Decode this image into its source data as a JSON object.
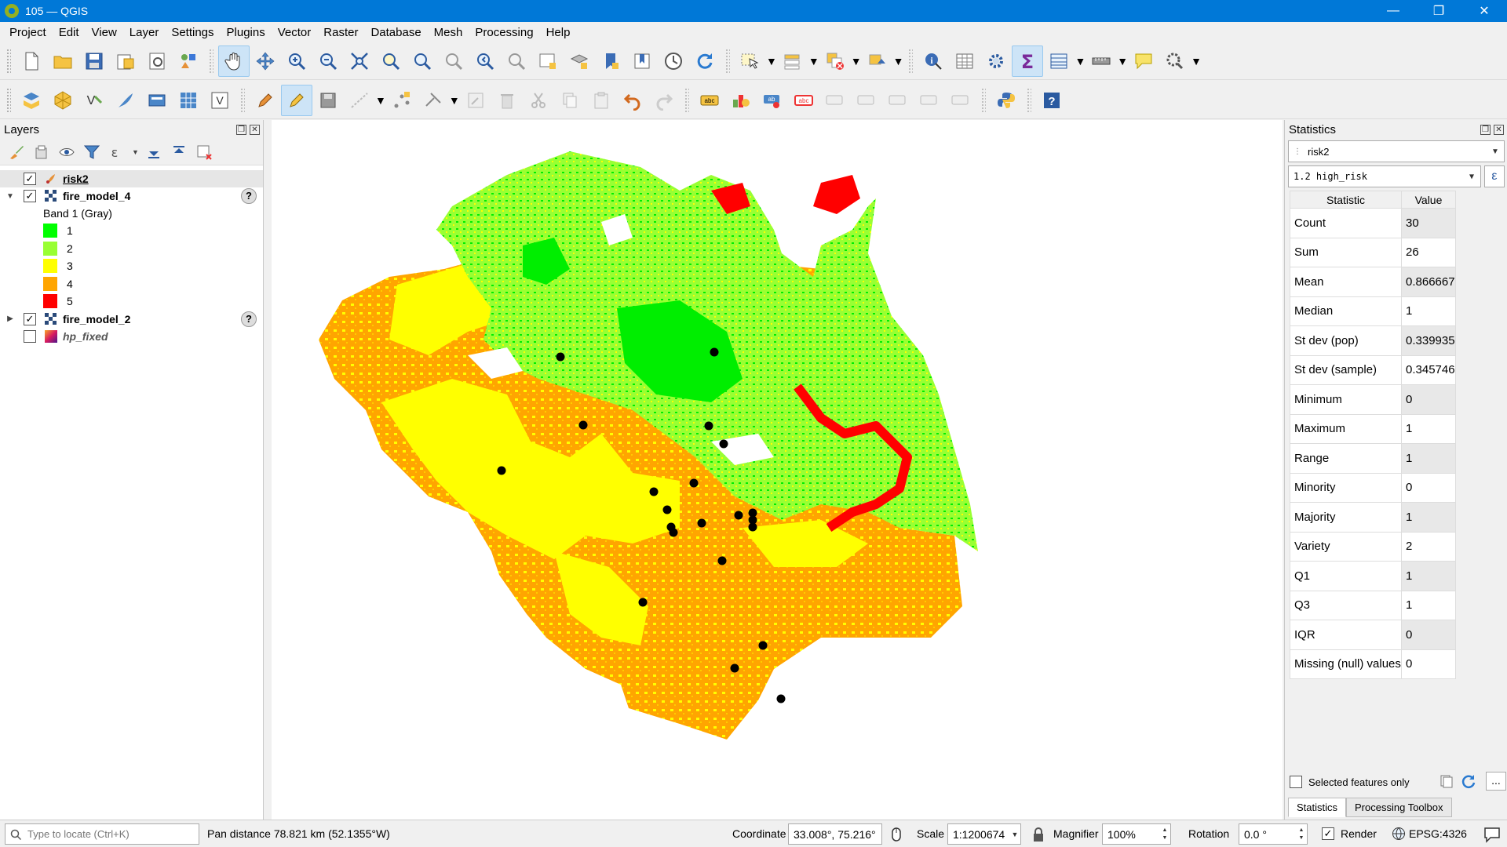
{
  "window": {
    "title": "105 — QGIS"
  },
  "menubar": [
    "Project",
    "Edit",
    "View",
    "Layer",
    "Settings",
    "Plugins",
    "Vector",
    "Raster",
    "Database",
    "Mesh",
    "Processing",
    "Help"
  ],
  "layers_panel": {
    "title": "Layers",
    "layers": [
      {
        "name": "risk2",
        "checked": true
      },
      {
        "name": "fire_model_4",
        "checked": true,
        "band_label": "Band 1 (Gray)",
        "legend": [
          {
            "label": "1",
            "color": "#00ff00"
          },
          {
            "label": "2",
            "color": "#99ff33"
          },
          {
            "label": "3",
            "color": "#ffff00"
          },
          {
            "label": "4",
            "color": "#ffa500"
          },
          {
            "label": "5",
            "color": "#ff0000"
          }
        ]
      },
      {
        "name": "fire_model_2",
        "checked": true
      },
      {
        "name": "hp_fixed",
        "checked": false
      }
    ]
  },
  "statistics_panel": {
    "title": "Statistics",
    "layer": "risk2",
    "field": "1.2 high_risk",
    "header_statistic": "Statistic",
    "header_value": "Value",
    "rows": [
      {
        "stat": "Count",
        "value": "30"
      },
      {
        "stat": "Sum",
        "value": "26"
      },
      {
        "stat": "Mean",
        "value": "0.866667"
      },
      {
        "stat": "Median",
        "value": "1"
      },
      {
        "stat": "St dev (pop)",
        "value": "0.339935"
      },
      {
        "stat": "St dev (sample)",
        "value": "0.345746"
      },
      {
        "stat": "Minimum",
        "value": "0"
      },
      {
        "stat": "Maximum",
        "value": "1"
      },
      {
        "stat": "Range",
        "value": "1"
      },
      {
        "stat": "Minority",
        "value": "0"
      },
      {
        "stat": "Majority",
        "value": "1"
      },
      {
        "stat": "Variety",
        "value": "2"
      },
      {
        "stat": "Q1",
        "value": "1"
      },
      {
        "stat": "Q3",
        "value": "1"
      },
      {
        "stat": "IQR",
        "value": "0"
      },
      {
        "stat": "Missing (null) values",
        "value": "0"
      }
    ],
    "selected_only_label": "Selected features only",
    "tabs": [
      "Statistics",
      "Processing Toolbox"
    ],
    "ellipsis": "..."
  },
  "statusbar": {
    "locate_placeholder": "Type to locate (Ctrl+K)",
    "message": "Pan distance 78.821 km (52.1355°W)",
    "coordinate_label": "Coordinate",
    "coordinate_value": "33.008°, 75.216°",
    "scale_label": "Scale",
    "scale_value": "1:1200674",
    "magnifier_label": "Magnifier",
    "magnifier_value": "100%",
    "rotation_label": "Rotation",
    "rotation_value": "0.0 °",
    "render_label": "Render",
    "crs": "EPSG:4326"
  }
}
